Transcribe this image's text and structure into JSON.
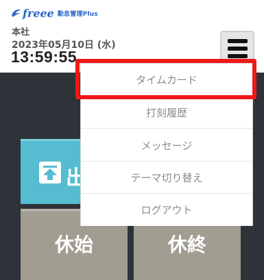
{
  "header": {
    "logo": {
      "brand": "freee",
      "product": "勤怠管理Plus",
      "icon": "freee-bird-icon"
    },
    "location": "本社",
    "date": "2023年05月10日 (水)",
    "time": "13:59:55",
    "menu_icon": "hamburger-menu-icon"
  },
  "menu": {
    "items": [
      {
        "label": "タイムカード",
        "highlighted": true
      },
      {
        "label": "打刻履歴"
      },
      {
        "label": "メッセージ"
      },
      {
        "label": "テーマ切り替え"
      },
      {
        "label": "ログアウト"
      }
    ]
  },
  "punch": {
    "clock_in_label": "出",
    "clock_in_icon": "upload-arrow-icon",
    "break_start_label": "休始",
    "break_end_label": "休終"
  },
  "colors": {
    "brand_blue": "#2864c8",
    "clock_in_teal": "#56bcd0",
    "break_gray": "#a29d91",
    "highlight_red": "#f01818",
    "dark_background": "#2f3238"
  }
}
